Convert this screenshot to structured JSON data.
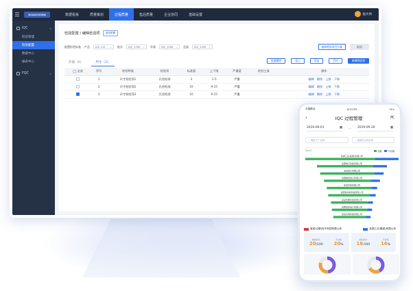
{
  "nav": {
    "logo": "ECOSYSTEM",
    "tabs": [
      "数据看板",
      "质量策划",
      "过程质量",
      "售后质量",
      "企业协同",
      "基础设置"
    ],
    "active_tab": 2,
    "user_avatar": "",
    "user_name": "张大伟"
  },
  "sidebar": {
    "groups": [
      {
        "label": "IQC",
        "items": [
          "检验管理",
          "检验配置",
          "数据中心",
          "报表中心"
        ],
        "active_item": 1
      },
      {
        "label": "FQC",
        "items": []
      }
    ]
  },
  "page": {
    "breadcrumb": "检验配置 / 编辑检验项",
    "breadcrumb_tag": "返回配置",
    "filters": [
      {
        "label": "配置检验标准",
        "value": ""
      },
      {
        "label": "产品",
        "value": "IQC-113"
      },
      {
        "label": "批次",
        "value": "IQC_1295"
      },
      {
        "label": "外观",
        "value": "IQC_1295"
      },
      {
        "label": "品类",
        "value": "IQC_1295"
      }
    ],
    "top_button": "复制检验项目方案",
    "top_grey_button": "取消",
    "tabs": [
      "外观（0）",
      "尺寸（3）"
    ],
    "active_tab": 1,
    "actions": [
      "批量删除",
      "导入",
      "导出",
      "打印",
      "新增检验项"
    ],
    "table": {
      "headers": [
        "全选",
        "序号",
        "检验种类",
        "检验项",
        "标准值",
        "上下限",
        "严重度",
        "检验工具",
        "操作"
      ],
      "rows": [
        {
          "checked": false,
          "no": "1",
          "kind": "尺寸检验项1",
          "item": "孔径检测",
          "std": "3",
          "range": "1-5",
          "sev": "严重",
          "tool": "",
          "ops": [
            "编辑",
            "删除",
            "上移",
            "下移"
          ]
        },
        {
          "checked": false,
          "no": "2",
          "kind": "尺寸检验项2",
          "item": "孔径检测",
          "std": "10",
          "range": "9-15",
          "sev": "严重",
          "tool": "",
          "ops": [
            "编辑",
            "删除",
            "上移",
            "下移"
          ]
        },
        {
          "checked": true,
          "no": "3",
          "kind": "尺寸检验项3",
          "item": "孔径检测",
          "std": "10",
          "range": "9-15",
          "sev": "严重",
          "tool": "",
          "ops": [
            "编辑",
            "删除",
            "上移",
            "下移"
          ]
        }
      ]
    }
  },
  "phone": {
    "carrier": "中国移动",
    "time": "8:43 PM",
    "battery": "74%",
    "title": "IQC 过程管理",
    "date_from": "2019-09-01",
    "date_to": "2019-09-30",
    "date_sep": "—",
    "search_1": "搜索工厂名称",
    "search_2": "搜索供应商名称",
    "chart_label": "Top10",
    "legend": [
      "合格",
      "不合格"
    ],
    "companies": [
      "某某(合肥)电子科技有限公司",
      "芜湖工业(集团)有限公司"
    ],
    "kpis": [
      {
        "l1": "抽检批次",
        "v1": "20",
        "t1": "/100",
        "l2": "不合格",
        "v2": "20",
        "u2": "%"
      },
      {
        "l1": "抽检批次",
        "v1": "16",
        "t1": "/100",
        "l2": "不合格",
        "v2": "16",
        "u2": "%"
      }
    ]
  },
  "chart_data": {
    "type": "bar",
    "title": "",
    "categories": [
      "芜湖工业(集团)有限公司",
      "合肥电子科技有限公司",
      "某某电子有限公司",
      "合肥精密电子有限公司",
      "某某科技有限公司",
      "合肥新材料科技有限公司",
      "某某智能科技有限公司",
      "合肥某某电子有限公司",
      "某某光电科技有限公司"
    ],
    "series": [
      {
        "name": "合格",
        "values": [
          75,
          60,
          58,
          50,
          48,
          45,
          40,
          38,
          35
        ]
      },
      {
        "name": "不合格",
        "values": [
          25,
          15,
          10,
          10,
          6,
          6,
          5,
          5,
          5
        ]
      }
    ],
    "colors": {
      "pass": "#3bb35a",
      "fail": "#2f6fe8"
    }
  }
}
